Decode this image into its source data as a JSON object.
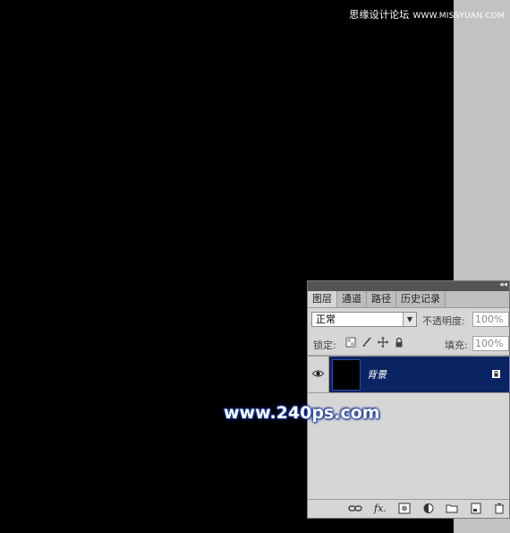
{
  "watermark_top": {
    "text": "思缘设计论坛",
    "site": "WWW.MISSYUAN.COM"
  },
  "watermark_center": "www.240ps.com",
  "layers_panel": {
    "tabs": [
      {
        "label": "图层",
        "active": true
      },
      {
        "label": "通道",
        "active": false
      },
      {
        "label": "路径",
        "active": false
      },
      {
        "label": "历史记录",
        "active": false
      }
    ],
    "blend_mode": "正常",
    "opacity_label": "不透明度:",
    "opacity_value": "100%",
    "lock_label": "锁定:",
    "fill_label": "填充:",
    "fill_value": "100%",
    "layer": {
      "name": "背景",
      "selected_color": "#0a2463"
    }
  },
  "icons": {
    "lock_row": [
      "lock-transparent-icon",
      "lock-brush-icon",
      "lock-move-icon",
      "lock-all-icon"
    ],
    "footer": [
      "link-layers-icon",
      "fx-icon",
      "add-mask-icon",
      "adjustment-layer-icon",
      "new-group-icon",
      "new-layer-icon",
      "delete-layer-icon"
    ]
  }
}
